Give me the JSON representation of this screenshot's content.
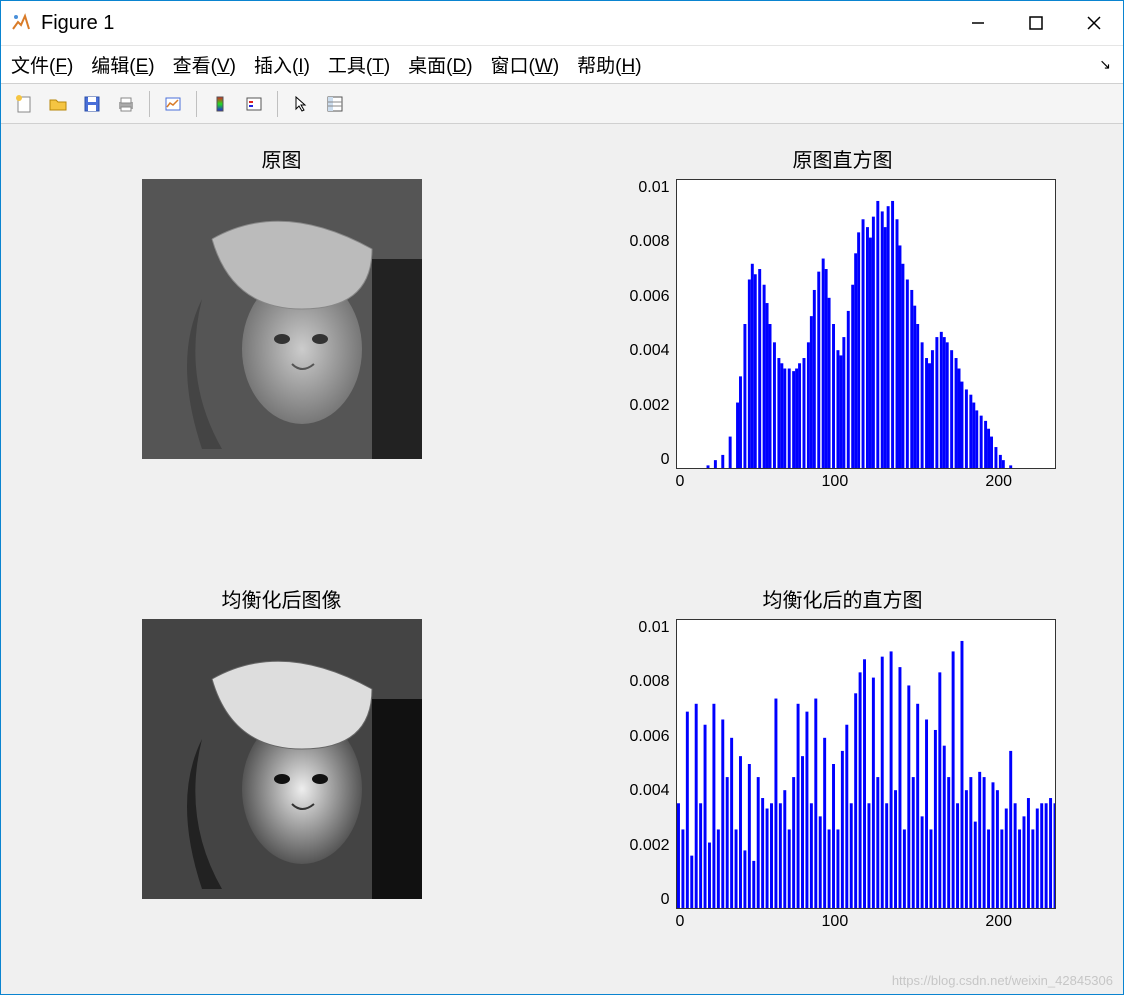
{
  "window": {
    "title": "Figure 1"
  },
  "menubar": {
    "file": "文件(F)",
    "edit": "编辑(E)",
    "view": "查看(V)",
    "insert": "插入(I)",
    "tools": "工具(T)",
    "desktop": "桌面(D)",
    "window": "窗口(W)",
    "help": "帮助(H)"
  },
  "subplots": {
    "img1_title": "原图",
    "hist1_title": "原图直方图",
    "img2_title": "均衡化后图像",
    "hist2_title": "均衡化后的直方图"
  },
  "watermark": "https://blog.csdn.net/weixin_42845306",
  "chart_data": [
    {
      "type": "bar",
      "title": "原图直方图",
      "xlabel": "",
      "ylabel": "",
      "xlim": [
        0,
        256
      ],
      "ylim": [
        0,
        0.011
      ],
      "xticks": [
        0,
        100,
        200
      ],
      "yticks": [
        0,
        0.002,
        0.004,
        0.006,
        0.008,
        0.01
      ],
      "x": [
        0,
        5,
        10,
        15,
        20,
        25,
        30,
        35,
        40,
        42,
        45,
        48,
        50,
        52,
        55,
        58,
        60,
        62,
        65,
        68,
        70,
        72,
        75,
        78,
        80,
        82,
        85,
        88,
        90,
        92,
        95,
        98,
        100,
        102,
        105,
        108,
        110,
        112,
        115,
        118,
        120,
        122,
        125,
        128,
        130,
        132,
        135,
        138,
        140,
        142,
        145,
        148,
        150,
        152,
        155,
        158,
        160,
        162,
        165,
        168,
        170,
        172,
        175,
        178,
        180,
        182,
        185,
        188,
        190,
        192,
        195,
        198,
        200,
        202,
        205,
        208,
        210,
        212,
        215,
        218,
        220,
        225,
        230,
        235,
        240,
        245,
        250,
        255
      ],
      "values": [
        0,
        0,
        0,
        0,
        0.0001,
        0.0003,
        0.0005,
        0.0012,
        0.0025,
        0.0035,
        0.0055,
        0.0072,
        0.0078,
        0.0074,
        0.0076,
        0.007,
        0.0063,
        0.0055,
        0.0048,
        0.0042,
        0.004,
        0.0038,
        0.0038,
        0.0037,
        0.0038,
        0.004,
        0.0042,
        0.0048,
        0.0058,
        0.0068,
        0.0075,
        0.008,
        0.0076,
        0.0065,
        0.0055,
        0.0045,
        0.0043,
        0.005,
        0.006,
        0.007,
        0.0082,
        0.009,
        0.0095,
        0.0092,
        0.0088,
        0.0096,
        0.0102,
        0.0098,
        0.0092,
        0.01,
        0.0102,
        0.0095,
        0.0085,
        0.0078,
        0.0072,
        0.0068,
        0.0062,
        0.0055,
        0.0048,
        0.0042,
        0.004,
        0.0045,
        0.005,
        0.0052,
        0.005,
        0.0048,
        0.0045,
        0.0042,
        0.0038,
        0.0033,
        0.003,
        0.0028,
        0.0025,
        0.0022,
        0.002,
        0.0018,
        0.0015,
        0.0012,
        0.0008,
        0.0005,
        0.0003,
        0.0001,
        0,
        0,
        0,
        0,
        0,
        0
      ]
    },
    {
      "type": "bar",
      "title": "均衡化后的直方图",
      "xlabel": "",
      "ylabel": "",
      "xlim": [
        0,
        256
      ],
      "ylim": [
        0,
        0.011
      ],
      "xticks": [
        0,
        100,
        200
      ],
      "yticks": [
        0,
        0.002,
        0.004,
        0.006,
        0.008,
        0.01
      ],
      "x": [
        0,
        3,
        6,
        9,
        12,
        15,
        18,
        21,
        24,
        27,
        30,
        33,
        36,
        39,
        42,
        45,
        48,
        51,
        54,
        57,
        60,
        63,
        66,
        69,
        72,
        75,
        78,
        81,
        84,
        87,
        90,
        93,
        96,
        99,
        102,
        105,
        108,
        111,
        114,
        117,
        120,
        123,
        126,
        129,
        132,
        135,
        138,
        141,
        144,
        147,
        150,
        153,
        156,
        159,
        162,
        165,
        168,
        171,
        174,
        177,
        180,
        183,
        186,
        189,
        192,
        195,
        198,
        201,
        204,
        207,
        210,
        213,
        216,
        219,
        222,
        225,
        228,
        231,
        234,
        237,
        240,
        243,
        246,
        249,
        252,
        255
      ],
      "values": [
        0.004,
        0.003,
        0.0075,
        0.002,
        0.0078,
        0.004,
        0.007,
        0.0025,
        0.0078,
        0.003,
        0.0072,
        0.005,
        0.0065,
        0.003,
        0.0058,
        0.0022,
        0.0055,
        0.0018,
        0.005,
        0.0042,
        0.0038,
        0.004,
        0.008,
        0.004,
        0.0045,
        0.003,
        0.005,
        0.0078,
        0.0058,
        0.0075,
        0.004,
        0.008,
        0.0035,
        0.0065,
        0.003,
        0.0055,
        0.003,
        0.006,
        0.007,
        0.004,
        0.0082,
        0.009,
        0.0095,
        0.004,
        0.0088,
        0.005,
        0.0096,
        0.004,
        0.0098,
        0.0045,
        0.0092,
        0.003,
        0.0085,
        0.005,
        0.0078,
        0.0035,
        0.0072,
        0.003,
        0.0068,
        0.009,
        0.0062,
        0.005,
        0.0098,
        0.004,
        0.0102,
        0.0045,
        0.005,
        0.0033,
        0.0052,
        0.005,
        0.003,
        0.0048,
        0.0045,
        0.003,
        0.0038,
        0.006,
        0.004,
        0.003,
        0.0035,
        0.0042,
        0.003,
        0.0038,
        0.004,
        0.004,
        0.0042,
        0.004
      ]
    }
  ]
}
